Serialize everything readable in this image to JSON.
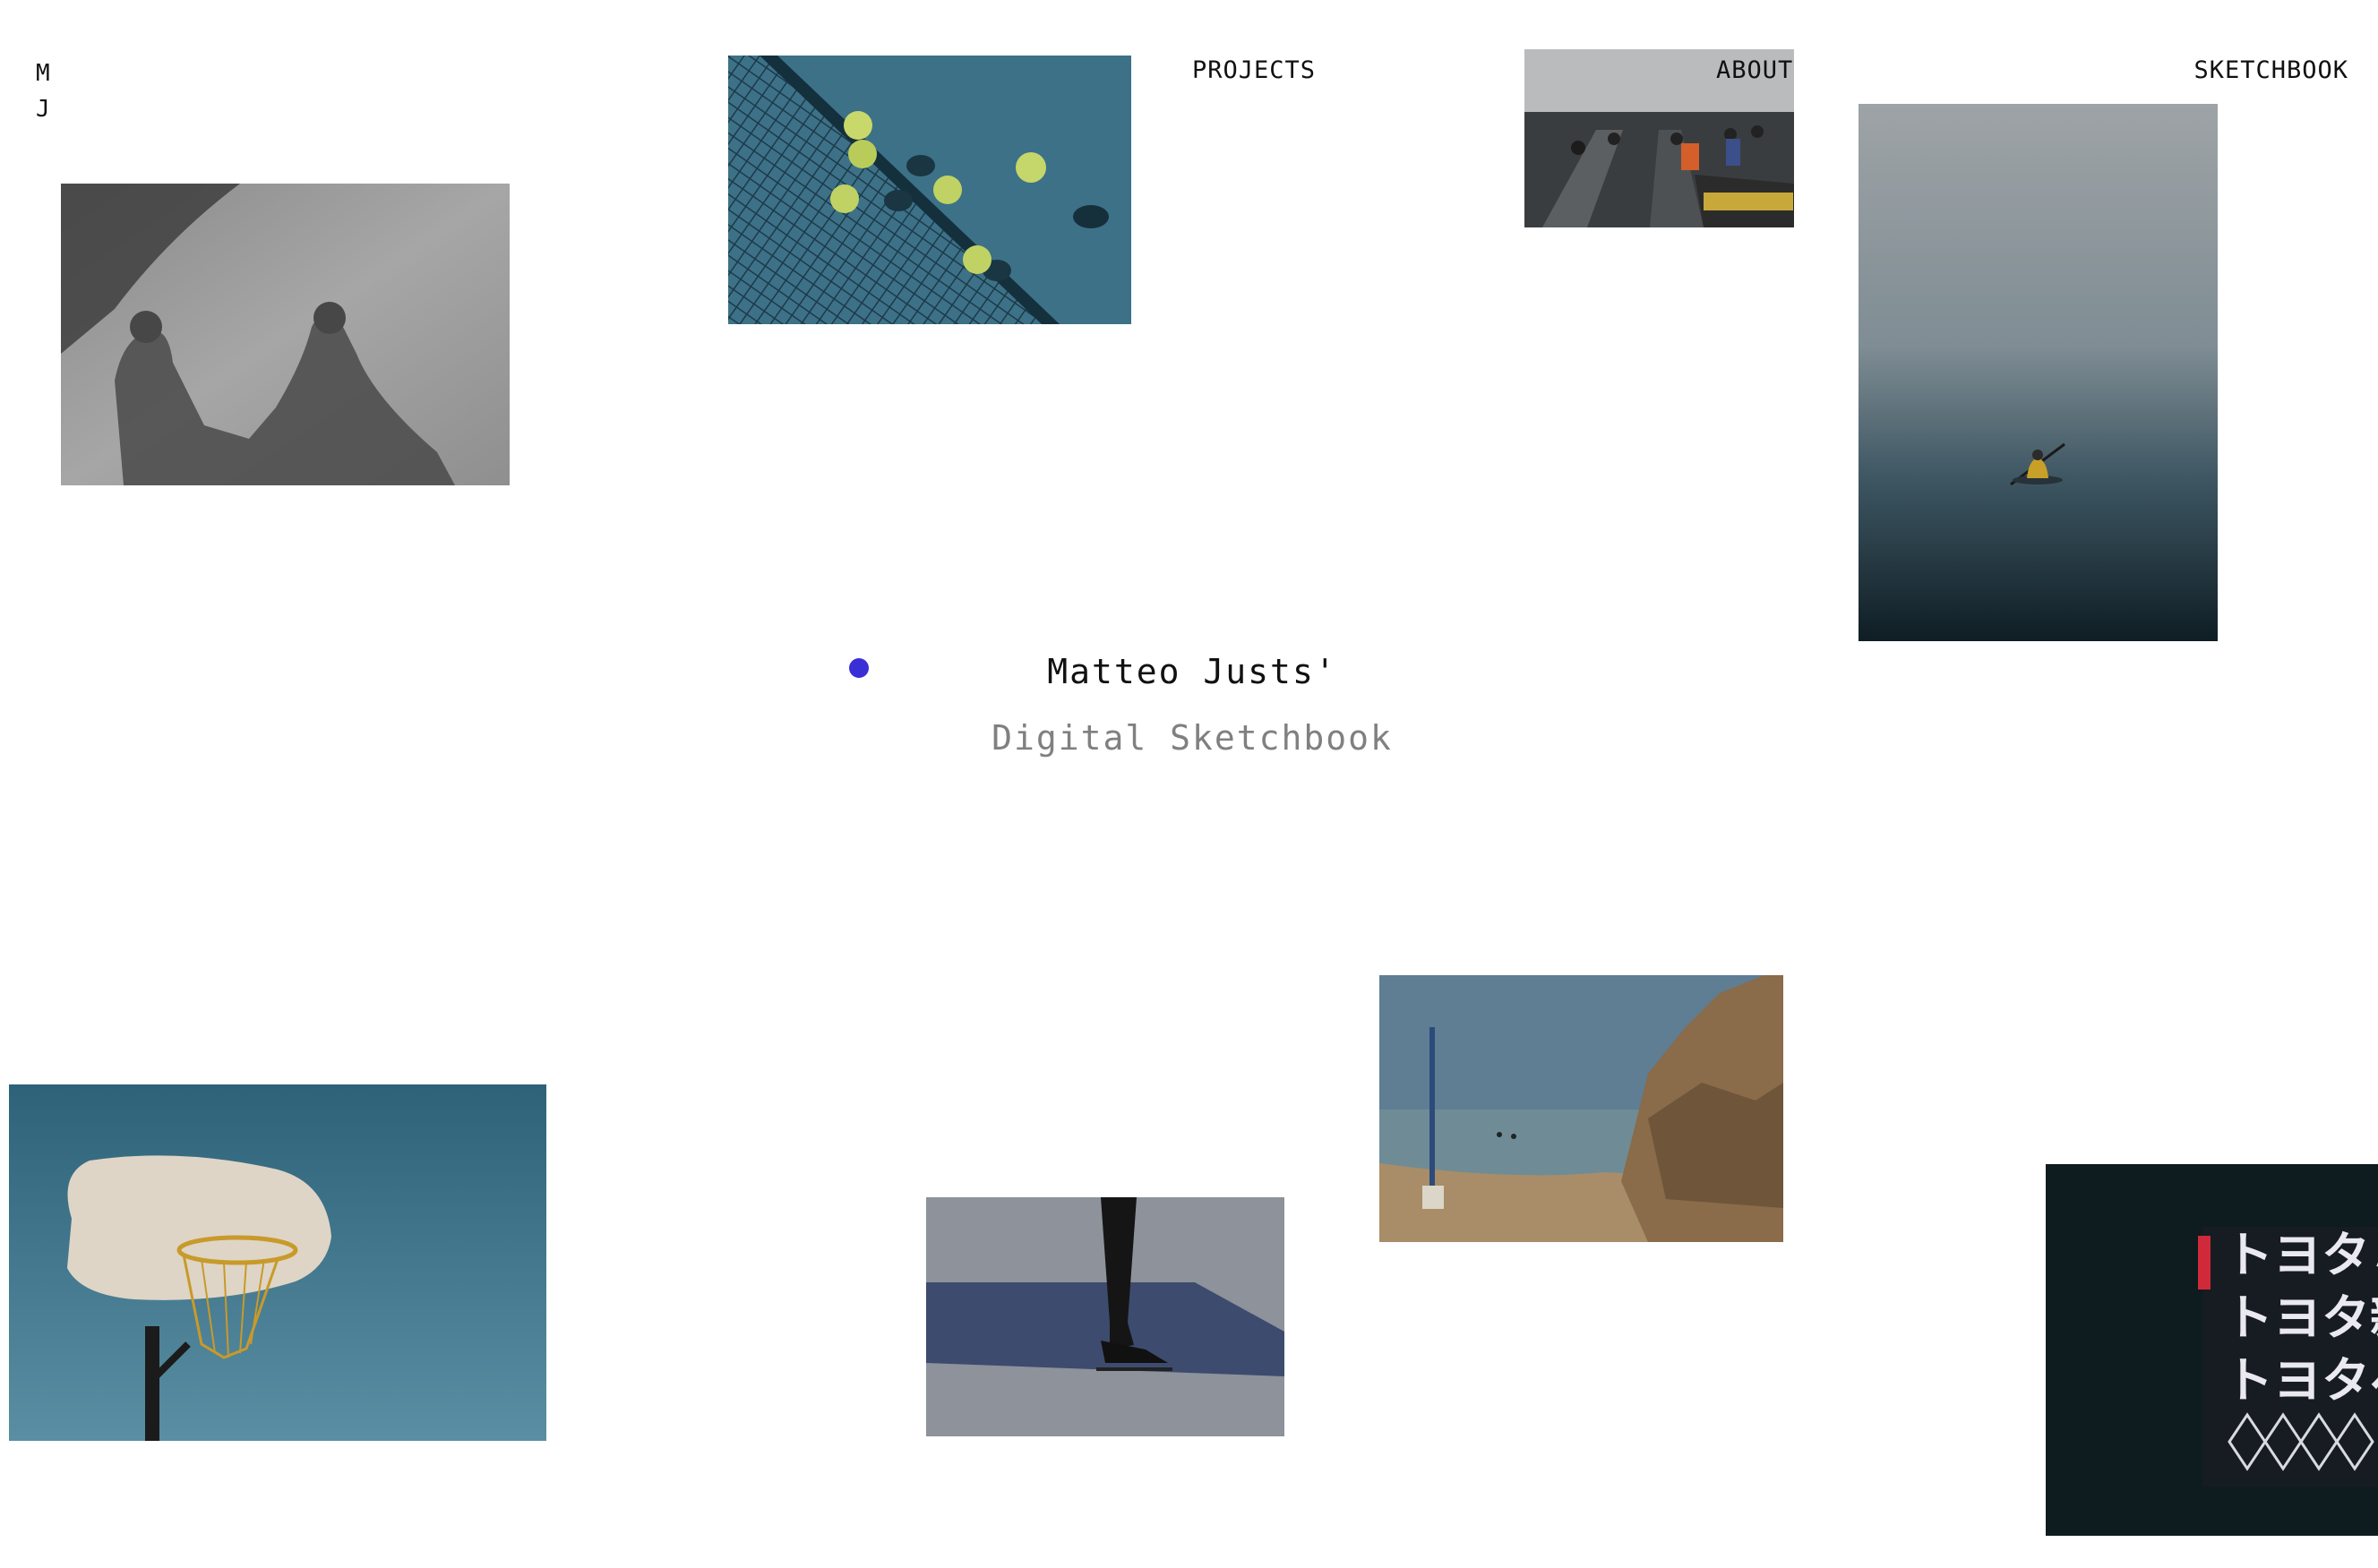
{
  "logo": {
    "line1": "M",
    "line2": "J"
  },
  "nav": {
    "projects": "PROJECTS",
    "about": "ABOUT",
    "sketchbook": "SKETCHBOOK"
  },
  "hero": {
    "title": "Matteo Justs'",
    "subtitle": "Digital Sketchbook"
  },
  "accent_color": "#3a2fd6",
  "sign_text": [
    "トヨタミ",
    "トヨタ新",
    "トヨタベ"
  ],
  "photos": [
    "shadows-holding-hands",
    "tennis-balls-net",
    "escalator-crowd",
    "kayak-fog",
    "basketball-hoop",
    "ice-skater",
    "rocky-beach",
    "neon-sign"
  ]
}
